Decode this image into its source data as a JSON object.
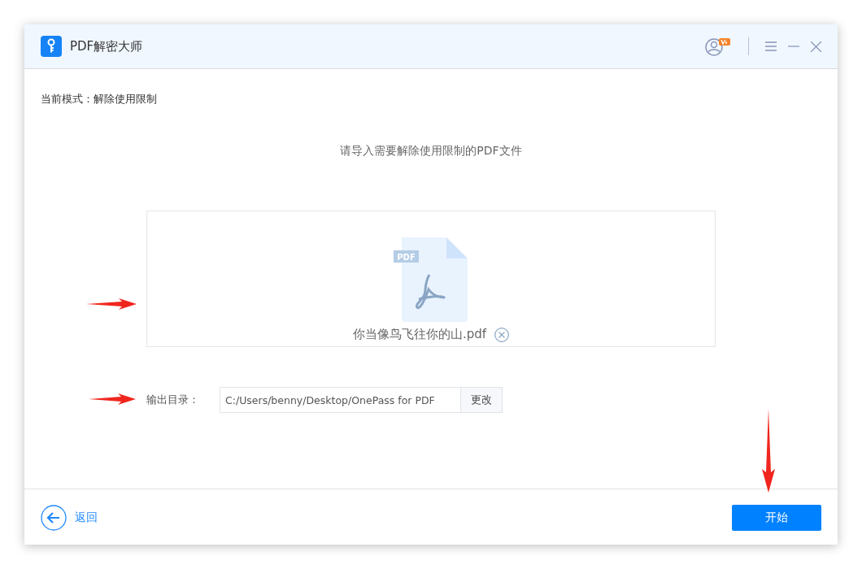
{
  "window": {
    "title": "PDF解密大师"
  },
  "mode": {
    "label": "当前模式：",
    "value": "解除使用限制"
  },
  "instruction": "请导入需要解除使用限制的PDF文件",
  "file": {
    "badge": "PDF",
    "name": "你当像鸟飞往你的山.pdf"
  },
  "output": {
    "label": "输出目录：",
    "path": "C:/Users/benny/Desktop/OnePass for PDF",
    "button": "更改"
  },
  "footer": {
    "back": "返回",
    "start": "开始"
  }
}
